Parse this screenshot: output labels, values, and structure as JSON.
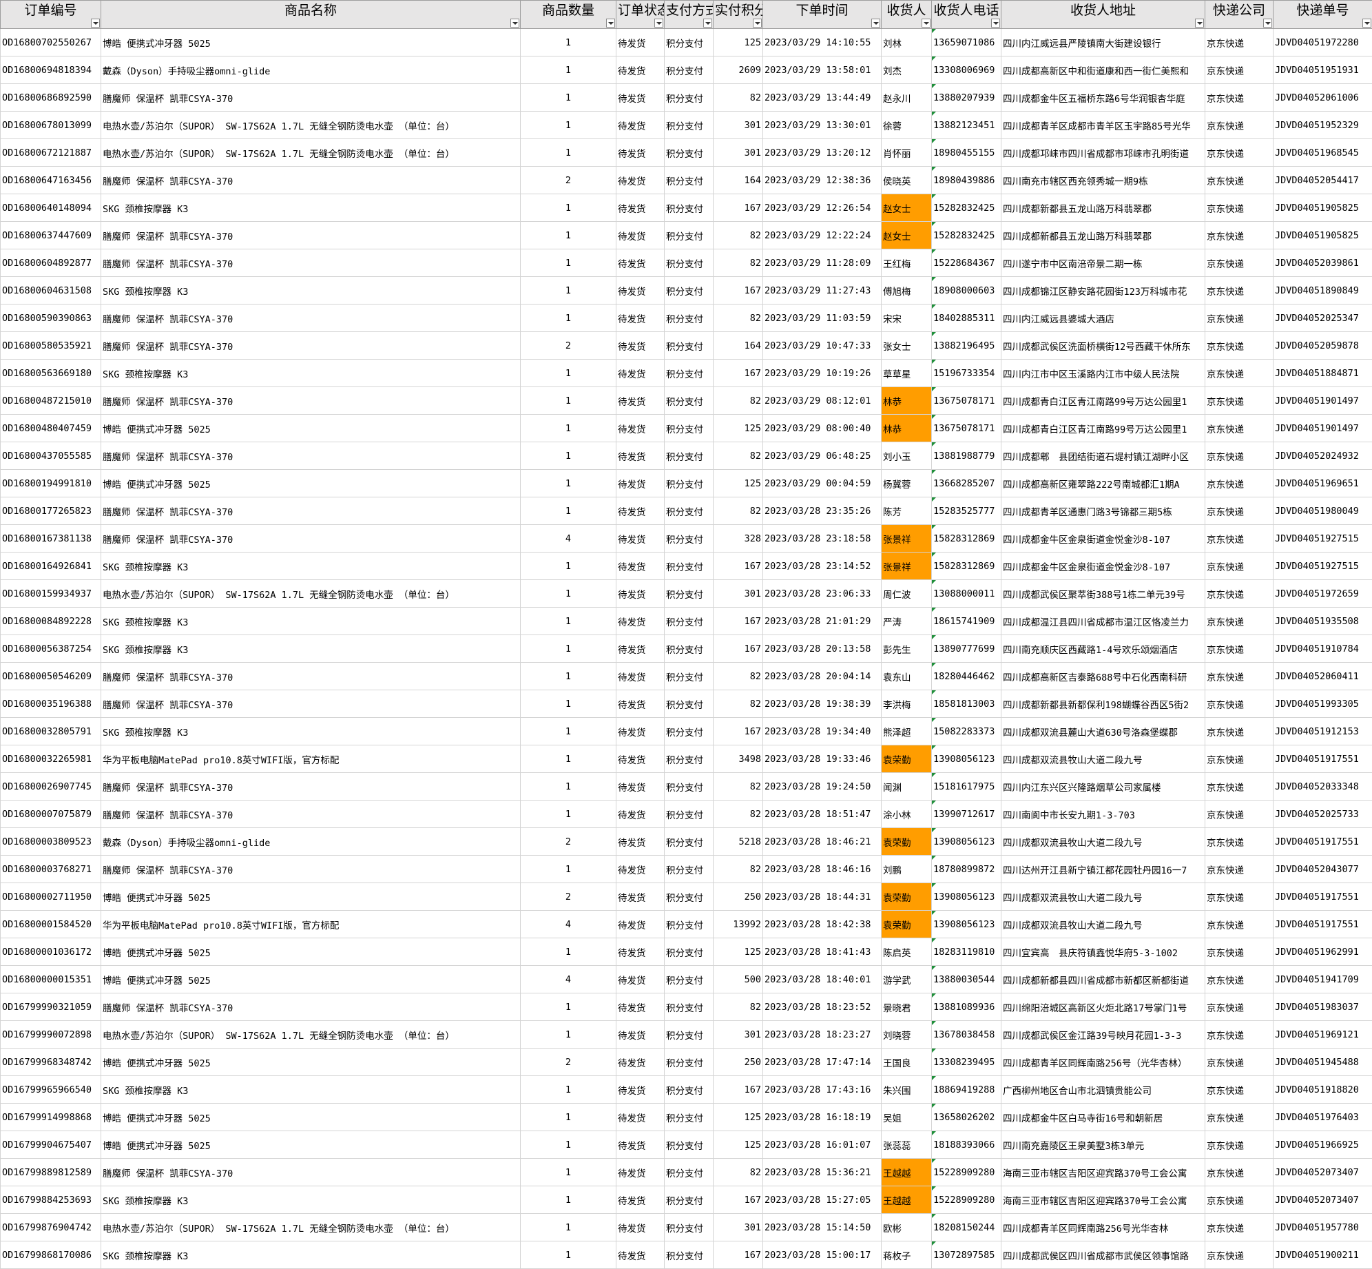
{
  "sheet": {
    "headers": [
      "订单编号",
      "商品名称",
      "商品数量",
      "订单状态",
      "支付方式",
      "实付积分",
      "下单时间",
      "收货人",
      "收货人电话",
      "收货人地址",
      "快递公司",
      "快递单号"
    ],
    "colors": {
      "highlight": "#ff9d00",
      "header_bg": "#e7e6e6",
      "gridline": "#d4d4d4",
      "comment_marker": "#1f8f3a"
    },
    "icons": {
      "filter": "filter-dropdown-icon"
    },
    "rows": [
      {
        "id": "OD16800702550267",
        "product": "博皓 便携式冲牙器 5025",
        "qty": "1",
        "status": "待发货",
        "pay": "积分支付",
        "points": "125",
        "time": "2023/03/29 14:10:55",
        "name": "刘林",
        "hl": false,
        "phone": "13659071086",
        "address": "四川内江威远县严陵镇南大街建设银行",
        "courier": "京东快递",
        "tracking": "JDVD04051972280"
      },
      {
        "id": "OD16800694818394",
        "product": "戴森（Dyson）手持吸尘器omni-glide",
        "qty": "1",
        "status": "待发货",
        "pay": "积分支付",
        "points": "2609",
        "time": "2023/03/29 13:58:01",
        "name": "刘杰",
        "hl": false,
        "phone": "13308006969",
        "address": "四川成都高新区中和街道康和西一街仁美熙和",
        "courier": "京东快递",
        "tracking": "JDVD04051951931"
      },
      {
        "id": "OD16800686892590",
        "product": "膳魔师 保温杯 凯菲CSYA-370",
        "qty": "1",
        "status": "待发货",
        "pay": "积分支付",
        "points": "82",
        "time": "2023/03/29 13:44:49",
        "name": "赵永川",
        "hl": false,
        "phone": "13880207939",
        "address": "四川成都金牛区五福桥东路6号华润银杏华庭",
        "courier": "京东快递",
        "tracking": "JDVD04052061006"
      },
      {
        "id": "OD16800678013099",
        "product": "电热水壶/苏泊尔（SUPOR） SW-17S62A 1.7L 无缝全钢防烫电水壶 （单位：台）",
        "qty": "1",
        "status": "待发货",
        "pay": "积分支付",
        "points": "301",
        "time": "2023/03/29 13:30:01",
        "name": "徐蓉",
        "hl": false,
        "phone": "13882123451",
        "address": "四川成都青羊区成都市青羊区玉宇路85号光华",
        "courier": "京东快递",
        "tracking": "JDVD04051952329"
      },
      {
        "id": "OD16800672121887",
        "product": "电热水壶/苏泊尔（SUPOR） SW-17S62A 1.7L 无缝全钢防烫电水壶 （单位：台）",
        "qty": "1",
        "status": "待发货",
        "pay": "积分支付",
        "points": "301",
        "time": "2023/03/29 13:20:12",
        "name": "肖怀丽",
        "hl": false,
        "phone": "18980455155",
        "address": "四川成都邛崃市四川省成都市邛崃市孔明街道",
        "courier": "京东快递",
        "tracking": "JDVD04051968545"
      },
      {
        "id": "OD16800647163456",
        "product": "膳魔师 保温杯 凯菲CSYA-370",
        "qty": "2",
        "status": "待发货",
        "pay": "积分支付",
        "points": "164",
        "time": "2023/03/29 12:38:36",
        "name": "侯晓英",
        "hl": false,
        "phone": "18980439886",
        "address": "四川南充市辖区西充领秀城一期9栋",
        "courier": "京东快递",
        "tracking": "JDVD04052054417"
      },
      {
        "id": "OD16800640148094",
        "product": "SKG 颈椎按摩器 K3",
        "qty": "1",
        "status": "待发货",
        "pay": "积分支付",
        "points": "167",
        "time": "2023/03/29 12:26:54",
        "name": "赵女士",
        "hl": true,
        "phone": "15282832425",
        "address": "四川成都新都县五龙山路万科翡翠郡",
        "courier": "京东快递",
        "tracking": "JDVD04051905825"
      },
      {
        "id": "OD16800637447609",
        "product": "膳魔师 保温杯 凯菲CSYA-370",
        "qty": "1",
        "status": "待发货",
        "pay": "积分支付",
        "points": "82",
        "time": "2023/03/29 12:22:24",
        "name": "赵女士",
        "hl": true,
        "phone": "15282832425",
        "address": "四川成都新都县五龙山路万科翡翠郡",
        "courier": "京东快递",
        "tracking": "JDVD04051905825"
      },
      {
        "id": "OD16800604892877",
        "product": "膳魔师 保温杯 凯菲CSYA-370",
        "qty": "1",
        "status": "待发货",
        "pay": "积分支付",
        "points": "82",
        "time": "2023/03/29 11:28:09",
        "name": "王红梅",
        "hl": false,
        "phone": "15228684367",
        "address": "四川遂宁市中区南涪帝景二期一栋",
        "courier": "京东快递",
        "tracking": "JDVD04052039861"
      },
      {
        "id": "OD16800604631508",
        "product": "SKG 颈椎按摩器 K3",
        "qty": "1",
        "status": "待发货",
        "pay": "积分支付",
        "points": "167",
        "time": "2023/03/29 11:27:43",
        "name": "傅旭梅",
        "hl": false,
        "phone": "18908000603",
        "address": "四川成都锦江区静安路花园街123万科城市花",
        "courier": "京东快递",
        "tracking": "JDVD04051890849"
      },
      {
        "id": "OD16800590390863",
        "product": "膳魔师 保温杯 凯菲CSYA-370",
        "qty": "1",
        "status": "待发货",
        "pay": "积分支付",
        "points": "82",
        "time": "2023/03/29 11:03:59",
        "name": "宋宋",
        "hl": false,
        "phone": "18402885311",
        "address": "四川内江威远县婆城大酒店",
        "courier": "京东快递",
        "tracking": "JDVD04052025347"
      },
      {
        "id": "OD16800580535921",
        "product": "膳魔师 保温杯 凯菲CSYA-370",
        "qty": "2",
        "status": "待发货",
        "pay": "积分支付",
        "points": "164",
        "time": "2023/03/29 10:47:33",
        "name": "张女士",
        "hl": false,
        "phone": "13882196495",
        "address": "四川成都武侯区洗面桥横街12号西藏干休所东",
        "courier": "京东快递",
        "tracking": "JDVD04052059878"
      },
      {
        "id": "OD16800563669180",
        "product": "SKG 颈椎按摩器 K3",
        "qty": "1",
        "status": "待发货",
        "pay": "积分支付",
        "points": "167",
        "time": "2023/03/29 10:19:26",
        "name": "草草星",
        "hl": false,
        "phone": "15196733354",
        "address": "四川内江市中区玉溪路内江市中级人民法院",
        "courier": "京东快递",
        "tracking": "JDVD04051884871"
      },
      {
        "id": "OD16800487215010",
        "product": "膳魔师 保温杯 凯菲CSYA-370",
        "qty": "1",
        "status": "待发货",
        "pay": "积分支付",
        "points": "82",
        "time": "2023/03/29 08:12:01",
        "name": "林恭",
        "hl": true,
        "phone": "13675078171",
        "address": "四川成都青白江区青江南路99号万达公园里1",
        "courier": "京东快递",
        "tracking": "JDVD04051901497"
      },
      {
        "id": "OD16800480407459",
        "product": "博皓 便携式冲牙器 5025",
        "qty": "1",
        "status": "待发货",
        "pay": "积分支付",
        "points": "125",
        "time": "2023/03/29 08:00:40",
        "name": "林恭",
        "hl": true,
        "phone": "13675078171",
        "address": "四川成都青白江区青江南路99号万达公园里1",
        "courier": "京东快递",
        "tracking": "JDVD04051901497"
      },
      {
        "id": "OD16800437055585",
        "product": "膳魔师 保温杯 凯菲CSYA-370",
        "qty": "1",
        "status": "待发货",
        "pay": "积分支付",
        "points": "82",
        "time": "2023/03/29 06:48:25",
        "name": "刘小玉",
        "hl": false,
        "phone": "13881988779",
        "address": "四川成都郫　县团结街道石堤村镇江湖畔小区",
        "courier": "京东快递",
        "tracking": "JDVD04052024932"
      },
      {
        "id": "OD16800194991810",
        "product": "博皓 便携式冲牙器 5025",
        "qty": "1",
        "status": "待发货",
        "pay": "积分支付",
        "points": "125",
        "time": "2023/03/29 00:04:59",
        "name": "杨冀蓉",
        "hl": false,
        "phone": "13668285207",
        "address": "四川成都高新区雍翠路222号南城都汇1期A",
        "courier": "京东快递",
        "tracking": "JDVD04051969651"
      },
      {
        "id": "OD16800177265823",
        "product": "膳魔师 保温杯 凯菲CSYA-370",
        "qty": "1",
        "status": "待发货",
        "pay": "积分支付",
        "points": "82",
        "time": "2023/03/28 23:35:26",
        "name": "陈芳",
        "hl": false,
        "phone": "15283525777",
        "address": "四川成都青羊区通惠门路3号锦都三期5栋",
        "courier": "京东快递",
        "tracking": "JDVD04051980049"
      },
      {
        "id": "OD16800167381138",
        "product": "膳魔师 保温杯 凯菲CSYA-370",
        "qty": "4",
        "status": "待发货",
        "pay": "积分支付",
        "points": "328",
        "time": "2023/03/28 23:18:58",
        "name": "张景祥",
        "hl": true,
        "phone": "15828312869",
        "address": "四川成都金牛区金泉街道金悦金沙8-107",
        "courier": "京东快递",
        "tracking": "JDVD04051927515"
      },
      {
        "id": "OD16800164926841",
        "product": "SKG 颈椎按摩器 K3",
        "qty": "1",
        "status": "待发货",
        "pay": "积分支付",
        "points": "167",
        "time": "2023/03/28 23:14:52",
        "name": "张景祥",
        "hl": true,
        "phone": "15828312869",
        "address": "四川成都金牛区金泉街道金悦金沙8-107",
        "courier": "京东快递",
        "tracking": "JDVD04051927515"
      },
      {
        "id": "OD16800159934937",
        "product": "电热水壶/苏泊尔（SUPOR） SW-17S62A 1.7L 无缝全钢防烫电水壶 （单位：台）",
        "qty": "1",
        "status": "待发货",
        "pay": "积分支付",
        "points": "301",
        "time": "2023/03/28 23:06:33",
        "name": "周仁波",
        "hl": false,
        "phone": "13088000011",
        "address": "四川成都武侯区聚萃街388号1栋二单元39号",
        "courier": "京东快递",
        "tracking": "JDVD04051972659"
      },
      {
        "id": "OD16800084892228",
        "product": "SKG 颈椎按摩器 K3",
        "qty": "1",
        "status": "待发货",
        "pay": "积分支付",
        "points": "167",
        "time": "2023/03/28 21:01:29",
        "name": "严涛",
        "hl": false,
        "phone": "18615741909",
        "address": "四川成都温江县四川省成都市温江区恪凌兰力",
        "courier": "京东快递",
        "tracking": "JDVD04051935508"
      },
      {
        "id": "OD16800056387254",
        "product": "SKG 颈椎按摩器 K3",
        "qty": "1",
        "status": "待发货",
        "pay": "积分支付",
        "points": "167",
        "time": "2023/03/28 20:13:58",
        "name": "彭先生",
        "hl": false,
        "phone": "13890777699",
        "address": "四川南充顺庆区西藏路1-4号欢乐颂烟酒店",
        "courier": "京东快递",
        "tracking": "JDVD04051910784"
      },
      {
        "id": "OD16800050546209",
        "product": "膳魔师 保温杯 凯菲CSYA-370",
        "qty": "1",
        "status": "待发货",
        "pay": "积分支付",
        "points": "82",
        "time": "2023/03/28 20:04:14",
        "name": "袁东山",
        "hl": false,
        "phone": "18280446462",
        "address": "四川成都高新区吉泰路688号中石化西南科研",
        "courier": "京东快递",
        "tracking": "JDVD04052060411"
      },
      {
        "id": "OD16800035196388",
        "product": "膳魔师 保温杯 凯菲CSYA-370",
        "qty": "1",
        "status": "待发货",
        "pay": "积分支付",
        "points": "82",
        "time": "2023/03/28 19:38:39",
        "name": "李洪梅",
        "hl": false,
        "phone": "18581813003",
        "address": "四川成都新都县新都保利198蝴蝶谷西区5街2",
        "courier": "京东快递",
        "tracking": "JDVD04051993305"
      },
      {
        "id": "OD16800032805791",
        "product": "SKG 颈椎按摩器 K3",
        "qty": "1",
        "status": "待发货",
        "pay": "积分支付",
        "points": "167",
        "time": "2023/03/28 19:34:40",
        "name": "熊泽超",
        "hl": false,
        "phone": "15082283373",
        "address": "四川成都双流县麓山大道630号洛森堡蝶郡",
        "courier": "京东快递",
        "tracking": "JDVD04051912153"
      },
      {
        "id": "OD16800032265981",
        "product": "华为平板电脑MatePad pro10.8英寸WIFI版，官方标配",
        "qty": "1",
        "status": "待发货",
        "pay": "积分支付",
        "points": "3498",
        "time": "2023/03/28 19:33:46",
        "name": "袁荣勤",
        "hl": true,
        "phone": "13908056123",
        "address": "四川成都双流县牧山大道二段九号",
        "courier": "京东快递",
        "tracking": "JDVD04051917551"
      },
      {
        "id": "OD16800026907745",
        "product": "膳魔师 保温杯 凯菲CSYA-370",
        "qty": "1",
        "status": "待发货",
        "pay": "积分支付",
        "points": "82",
        "time": "2023/03/28 19:24:50",
        "name": "闻渊",
        "hl": false,
        "phone": "15181617975",
        "address": "四川内江东兴区兴隆路烟草公司家属楼",
        "courier": "京东快递",
        "tracking": "JDVD04052033348"
      },
      {
        "id": "OD16800007075879",
        "product": "膳魔师 保温杯 凯菲CSYA-370",
        "qty": "1",
        "status": "待发货",
        "pay": "积分支付",
        "points": "82",
        "time": "2023/03/28 18:51:47",
        "name": "涂小林",
        "hl": false,
        "phone": "13990712617",
        "address": "四川南阆中市长安九期1-3-703",
        "courier": "京东快递",
        "tracking": "JDVD04052025733"
      },
      {
        "id": "OD16800003809523",
        "product": "戴森（Dyson）手持吸尘器omni-glide",
        "qty": "2",
        "status": "待发货",
        "pay": "积分支付",
        "points": "5218",
        "time": "2023/03/28 18:46:21",
        "name": "袁荣勤",
        "hl": true,
        "phone": "13908056123",
        "address": "四川成都双流县牧山大道二段九号",
        "courier": "京东快递",
        "tracking": "JDVD04051917551"
      },
      {
        "id": "OD16800003768271",
        "product": "膳魔师 保温杯 凯菲CSYA-370",
        "qty": "1",
        "status": "待发货",
        "pay": "积分支付",
        "points": "82",
        "time": "2023/03/28 18:46:16",
        "name": "刘鹏",
        "hl": false,
        "phone": "18780899872",
        "address": "四川达州开江县新宁镇江都花园牡丹园16一7",
        "courier": "京东快递",
        "tracking": "JDVD04052043077"
      },
      {
        "id": "OD16800002711950",
        "product": "博皓 便携式冲牙器 5025",
        "qty": "2",
        "status": "待发货",
        "pay": "积分支付",
        "points": "250",
        "time": "2023/03/28 18:44:31",
        "name": "袁荣勤",
        "hl": true,
        "phone": "13908056123",
        "address": "四川成都双流县牧山大道二段九号",
        "courier": "京东快递",
        "tracking": "JDVD04051917551"
      },
      {
        "id": "OD16800001584520",
        "product": "华为平板电脑MatePad pro10.8英寸WIFI版，官方标配",
        "qty": "4",
        "status": "待发货",
        "pay": "积分支付",
        "points": "13992",
        "time": "2023/03/28 18:42:38",
        "name": "袁荣勤",
        "hl": true,
        "phone": "13908056123",
        "address": "四川成都双流县牧山大道二段九号",
        "courier": "京东快递",
        "tracking": "JDVD04051917551"
      },
      {
        "id": "OD16800001036172",
        "product": "博皓 便携式冲牙器 5025",
        "qty": "1",
        "status": "待发货",
        "pay": "积分支付",
        "points": "125",
        "time": "2023/03/28 18:41:43",
        "name": "陈启英",
        "hl": false,
        "phone": "18283119810",
        "address": "四川宜宾高　县庆符镇鑫悦华府5-3-1002",
        "courier": "京东快递",
        "tracking": "JDVD04051962991"
      },
      {
        "id": "OD16800000015351",
        "product": "博皓 便携式冲牙器 5025",
        "qty": "4",
        "status": "待发货",
        "pay": "积分支付",
        "points": "500",
        "time": "2023/03/28 18:40:01",
        "name": "游学武",
        "hl": false,
        "phone": "13880030544",
        "address": "四川成都新都县四川省成都市新都区新都街道",
        "courier": "京东快递",
        "tracking": "JDVD04051941709"
      },
      {
        "id": "OD16799990321059",
        "product": "膳魔师 保温杯 凯菲CSYA-370",
        "qty": "1",
        "status": "待发货",
        "pay": "积分支付",
        "points": "82",
        "time": "2023/03/28 18:23:52",
        "name": "景晓君",
        "hl": false,
        "phone": "13881089936",
        "address": "四川绵阳涪城区高新区火炬北路17号掌门1号",
        "courier": "京东快递",
        "tracking": "JDVD04051983037"
      },
      {
        "id": "OD16799990072898",
        "product": "电热水壶/苏泊尔（SUPOR） SW-17S62A 1.7L 无缝全钢防烫电水壶 （单位：台）",
        "qty": "1",
        "status": "待发货",
        "pay": "积分支付",
        "points": "301",
        "time": "2023/03/28 18:23:27",
        "name": "刘晓蓉",
        "hl": false,
        "phone": "13678038458",
        "address": "四川成都武侯区金江路39号映月花园1-3-3",
        "courier": "京东快递",
        "tracking": "JDVD04051969121"
      },
      {
        "id": "OD16799968348742",
        "product": "博皓 便携式冲牙器 5025",
        "qty": "2",
        "status": "待发货",
        "pay": "积分支付",
        "points": "250",
        "time": "2023/03/28 17:47:14",
        "name": "王国良",
        "hl": false,
        "phone": "13308239495",
        "address": "四川成都青羊区同辉南路256号（光华杏林）",
        "courier": "京东快递",
        "tracking": "JDVD04051945488"
      },
      {
        "id": "OD16799965966540",
        "product": "SKG 颈椎按摩器 K3",
        "qty": "1",
        "status": "待发货",
        "pay": "积分支付",
        "points": "167",
        "time": "2023/03/28 17:43:16",
        "name": "朱兴围",
        "hl": false,
        "phone": "18869419288",
        "address": "广西柳州地区合山市北泗镇贵能公司",
        "courier": "京东快递",
        "tracking": "JDVD04051918820"
      },
      {
        "id": "OD16799914998868",
        "product": "博皓 便携式冲牙器 5025",
        "qty": "1",
        "status": "待发货",
        "pay": "积分支付",
        "points": "125",
        "time": "2023/03/28 16:18:19",
        "name": "吴姐",
        "hl": false,
        "phone": "13658026202",
        "address": "四川成都金牛区白马寺街16号和朝新居",
        "courier": "京东快递",
        "tracking": "JDVD04051976403"
      },
      {
        "id": "OD16799904675407",
        "product": "博皓 便携式冲牙器 5025",
        "qty": "1",
        "status": "待发货",
        "pay": "积分支付",
        "points": "125",
        "time": "2023/03/28 16:01:07",
        "name": "张蕊蕊",
        "hl": false,
        "phone": "18188393066",
        "address": "四川南充嘉陵区王泉美墅3栋3单元",
        "courier": "京东快递",
        "tracking": "JDVD04051966925"
      },
      {
        "id": "OD16799889812589",
        "product": "膳魔师 保温杯 凯菲CSYA-370",
        "qty": "1",
        "status": "待发货",
        "pay": "积分支付",
        "points": "82",
        "time": "2023/03/28 15:36:21",
        "name": "王越越",
        "hl": true,
        "phone": "15228909280",
        "address": "海南三亚市辖区吉阳区迎宾路370号工会公寓",
        "courier": "京东快递",
        "tracking": "JDVD04052073407"
      },
      {
        "id": "OD16799884253693",
        "product": "SKG 颈椎按摩器 K3",
        "qty": "1",
        "status": "待发货",
        "pay": "积分支付",
        "points": "167",
        "time": "2023/03/28 15:27:05",
        "name": "王越越",
        "hl": true,
        "phone": "15228909280",
        "address": "海南三亚市辖区吉阳区迎宾路370号工会公寓",
        "courier": "京东快递",
        "tracking": "JDVD04052073407"
      },
      {
        "id": "OD16799876904742",
        "product": "电热水壶/苏泊尔（SUPOR） SW-17S62A 1.7L 无缝全钢防烫电水壶 （单位：台）",
        "qty": "1",
        "status": "待发货",
        "pay": "积分支付",
        "points": "301",
        "time": "2023/03/28 15:14:50",
        "name": "欧彬",
        "hl": false,
        "phone": "18208150244",
        "address": "四川成都青羊区同辉南路256号光华杏林",
        "courier": "京东快递",
        "tracking": "JDVD04051957780"
      },
      {
        "id": "OD16799868170086",
        "product": "SKG 颈椎按摩器 K3",
        "qty": "1",
        "status": "待发货",
        "pay": "积分支付",
        "points": "167",
        "time": "2023/03/28 15:00:17",
        "name": "蒋枚子",
        "hl": false,
        "phone": "13072897585",
        "address": "四川成都武侯区四川省成都市武侯区领事馆路",
        "courier": "京东快递",
        "tracking": "JDVD04051900211"
      }
    ]
  }
}
